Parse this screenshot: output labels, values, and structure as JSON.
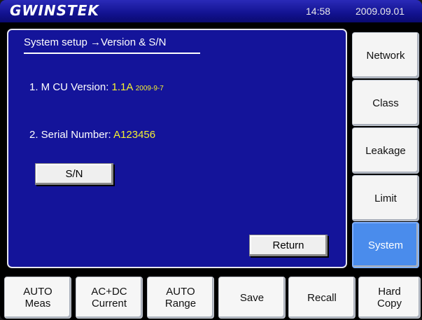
{
  "header": {
    "logo": "GWINSTEK",
    "time": "14:58",
    "date": "2009.09.01"
  },
  "panel": {
    "title": "System setup →Version & S/N",
    "mcu_label": "1. M CU Version:",
    "mcu_version": "1.1A",
    "mcu_date": "2009-9-7",
    "serial_label": "2. Serial Number:",
    "serial_value": "A123456",
    "sn_button": "S/N",
    "return_button": "Return"
  },
  "side_menu": [
    {
      "label": "Network",
      "active": false
    },
    {
      "label": "Class",
      "active": false
    },
    {
      "label": "Leakage",
      "active": false
    },
    {
      "label": "Limit",
      "active": false
    },
    {
      "label": "System",
      "active": true
    }
  ],
  "bottom_menu": [
    {
      "label": "AUTO\nMeas"
    },
    {
      "label": "AC+DC\nCurrent"
    },
    {
      "label": "AUTO\nRange"
    },
    {
      "label": "Save"
    },
    {
      "label": "Recall"
    },
    {
      "label": "Hard\nCopy"
    }
  ],
  "colors": {
    "panel_bg": "#14149a",
    "highlight_text": "#f4f030",
    "active_button": "#4a8cec"
  }
}
